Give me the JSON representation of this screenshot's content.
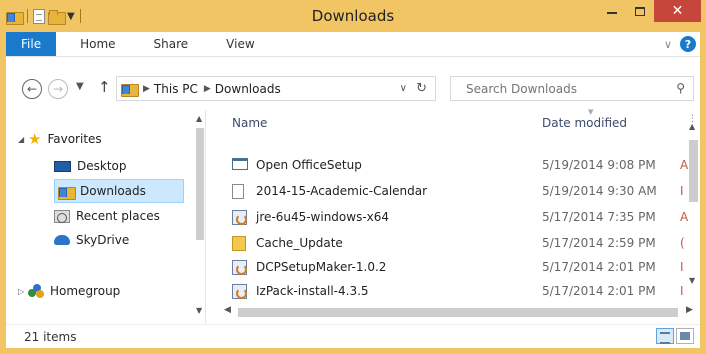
{
  "window": {
    "title": "Downloads"
  },
  "ribbon": {
    "tabs": [
      "File",
      "Home",
      "Share",
      "View"
    ]
  },
  "navigation": {
    "address_crumbs": [
      "This PC",
      "Downloads"
    ],
    "search_placeholder": "Search Downloads"
  },
  "nav_pane": {
    "favorites_label": "Favorites",
    "items": [
      {
        "label": "Desktop",
        "icon": "desktop-icon",
        "selected": false
      },
      {
        "label": "Downloads",
        "icon": "downloads-folder-icon",
        "selected": true
      },
      {
        "label": "Recent places",
        "icon": "recent-places-icon",
        "selected": false
      },
      {
        "label": "SkyDrive",
        "icon": "skydrive-icon",
        "selected": false
      }
    ],
    "homegroup_label": "Homegroup"
  },
  "file_list": {
    "columns": [
      "Name",
      "Date modified"
    ],
    "rows": [
      {
        "name": "Open OfficeSetup",
        "date": "5/19/2014 9:08 PM",
        "icon": "application-icon",
        "type_hint": "A"
      },
      {
        "name": "2014-15-Academic-Calendar",
        "date": "5/19/2014 9:30 AM",
        "icon": "document-icon",
        "type_hint": "I"
      },
      {
        "name": "jre-6u45-windows-x64",
        "date": "5/17/2014 7:35 PM",
        "icon": "java-installer-icon",
        "type_hint": "A"
      },
      {
        "name": "Cache_Update",
        "date": "5/17/2014 2:59 PM",
        "icon": "folder-icon",
        "type_hint": "("
      },
      {
        "name": "DCPSetupMaker-1.0.2",
        "date": "5/17/2014 2:01 PM",
        "icon": "java-installer-icon",
        "type_hint": "I"
      },
      {
        "name": "IzPack-install-4.3.5",
        "date": "5/17/2014 2:01 PM",
        "icon": "java-installer-icon",
        "type_hint": "I"
      }
    ]
  },
  "status": {
    "item_count": "21 items"
  },
  "colors": {
    "title_bar": "#f2c564",
    "file_tab": "#1979ca",
    "close_button": "#c7463b",
    "selection": "#cce8ff"
  }
}
